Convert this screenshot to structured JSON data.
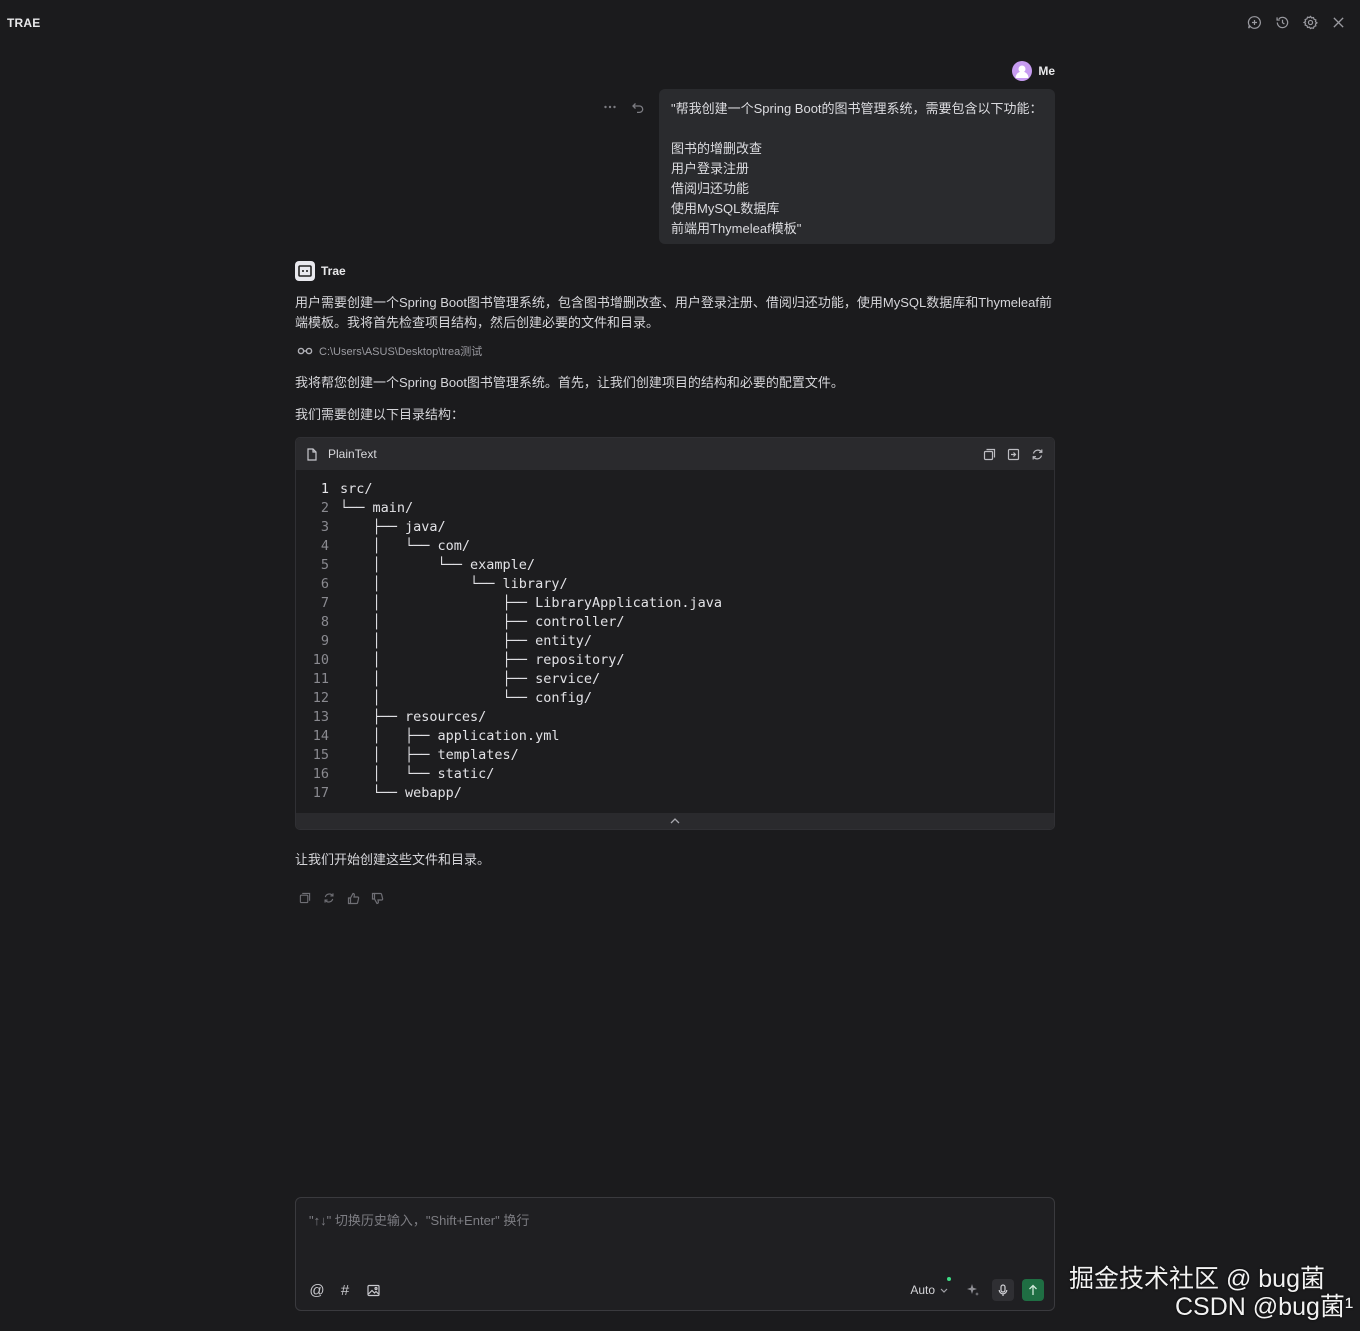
{
  "app": {
    "title": "TRAE"
  },
  "topbar": {
    "icons": [
      "new-chat-icon",
      "history-icon",
      "settings-icon",
      "close-icon"
    ]
  },
  "user_message": {
    "author": "Me",
    "lines": [
      "\"帮我创建一个Spring Boot的图书管理系统，需要包含以下功能：",
      "",
      "图书的增删改查",
      "用户登录注册",
      "借阅归还功能",
      "使用MySQL数据库",
      "前端用Thymeleaf模板\""
    ]
  },
  "assistant": {
    "name": "Trae",
    "para1": "用户需要创建一个Spring Boot图书管理系统，包含图书增删改查、用户登录注册、借阅归还功能，使用MySQL数据库和Thymeleaf前端模板。我将首先检查项目结构，然后创建必要的文件和目录。",
    "path": "C:\\Users\\ASUS\\Desktop\\trea测试",
    "para2": "我将帮您创建一个Spring Boot图书管理系统。首先，让我们创建项目的结构和必要的配置文件。",
    "para3": "我们需要创建以下目录结构：",
    "code": {
      "language": "PlainText",
      "lines": [
        "src/",
        "└── main/",
        "    ├── java/",
        "    │   └── com/",
        "    │       └── example/",
        "    │           └── library/",
        "    │               ├── LibraryApplication.java",
        "    │               ├── controller/",
        "    │               ├── entity/",
        "    │               ├── repository/",
        "    │               ├── service/",
        "    │               └── config/",
        "    ├── resources/",
        "    │   ├── application.yml",
        "    │   ├── templates/",
        "    │   └── static/",
        "    └── webapp/"
      ]
    },
    "para4": "让我们开始创建这些文件和目录。"
  },
  "input": {
    "placeholder": "\"↑↓\" 切换历史输入，\"Shift+Enter\" 换行",
    "mode": "Auto"
  },
  "watermark": {
    "line1": "掘金技术社区 @ bug菌",
    "line2": "CSDN @bug菌¹"
  }
}
